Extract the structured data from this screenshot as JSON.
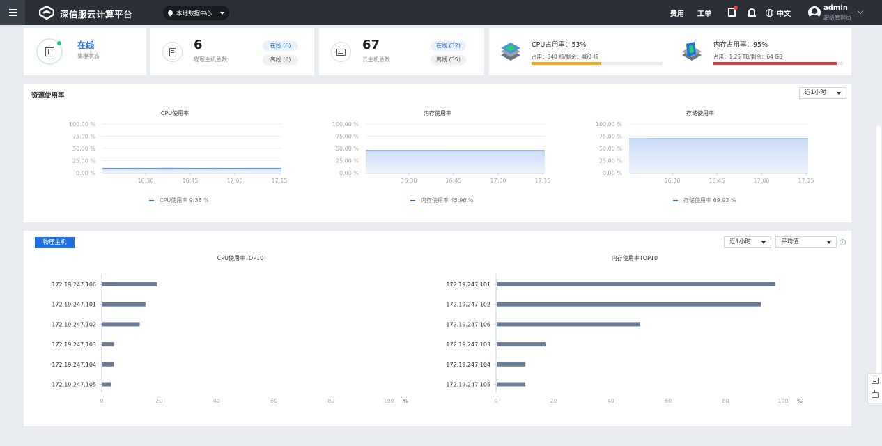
{
  "topbar": {
    "brand": "深信服云计算平台",
    "datacenter": "本地数据中心",
    "nav_fee": "费用",
    "nav_order": "工单",
    "lang": "中文",
    "user_name": "admin",
    "user_role": "超级管理员"
  },
  "cards": {
    "cluster": {
      "status": "在线",
      "label": "集群状态"
    },
    "hosts": {
      "total": "6",
      "label": "物理主机总数",
      "online": "在线 (6)",
      "offline": "离线 (0)"
    },
    "vms": {
      "total": "67",
      "label": "云主机总数",
      "online": "在线 (32)",
      "offline": "离线 (35)"
    },
    "cpu": {
      "title": "CPU占用率：53%",
      "detail": "占用：540 核/剩余：480 核",
      "percent": 53,
      "color": "#f5a623"
    },
    "mem": {
      "title": "内存占用率：95%",
      "detail": "占用：1.25 TB/剩余：64 GB",
      "percent": 95,
      "color": "#e0413f"
    }
  },
  "resource_panel": {
    "title": "资源使用率",
    "range": "近1小时",
    "charts": [
      {
        "title": "CPU使用率",
        "legend": "CPU使用率 9.38 %"
      },
      {
        "title": "内存使用率",
        "legend": "内存使用率 45.96 %"
      },
      {
        "title": "存储使用率",
        "legend": "存储使用率 69.92 %"
      }
    ]
  },
  "host_panel": {
    "tab": "物理主机",
    "range": "近1小时",
    "agg": "平均值",
    "cpu_title": "CPU使用率TOP10",
    "mem_title": "内存使用率TOP10"
  },
  "chart_data": [
    {
      "type": "area",
      "title": "CPU使用率",
      "yticks": [
        "100.00 %",
        "75.00 %",
        "50.00 %",
        "25.00 %",
        "0.00 %"
      ],
      "xticks": [
        "16:30",
        "16:45",
        "17:00",
        "17:15"
      ],
      "ylim": [
        0,
        100
      ],
      "series": [
        {
          "name": "CPU使用率",
          "values": [
            9.4,
            9.2,
            9.5,
            9.3,
            9.6,
            9.4,
            9.3,
            9.5,
            9.2,
            9.4,
            9.5,
            9.38
          ]
        }
      ]
    },
    {
      "type": "area",
      "title": "内存使用率",
      "yticks": [
        "100.00 %",
        "75.00 %",
        "50.00 %",
        "25.00 %",
        "0.00 %"
      ],
      "xticks": [
        "16:30",
        "16:45",
        "17:00",
        "17:15"
      ],
      "ylim": [
        0,
        100
      ],
      "series": [
        {
          "name": "内存使用率",
          "values": [
            45.9,
            45.96,
            45.95,
            45.96,
            45.97,
            45.96,
            45.95,
            45.96,
            45.96,
            45.97,
            45.96,
            45.96
          ]
        }
      ]
    },
    {
      "type": "area",
      "title": "存储使用率",
      "yticks": [
        "100.00 %",
        "75.00 %",
        "50.00 %",
        "25.00 %",
        "0.00 %"
      ],
      "xticks": [
        "16:30",
        "16:45",
        "17:00",
        "17:15"
      ],
      "ylim": [
        0,
        100
      ],
      "series": [
        {
          "name": "存储使用率",
          "values": [
            69.9,
            69.9,
            69.92,
            69.92,
            69.92,
            69.92,
            69.92,
            69.92,
            69.92,
            69.92,
            69.92,
            69.92
          ]
        }
      ]
    },
    {
      "type": "bar",
      "title": "CPU使用率TOP10",
      "categories": [
        "172.19.247.106",
        "172.19.247.101",
        "172.19.247.102",
        "172.19.247.103",
        "172.19.247.104",
        "172.19.247.105"
      ],
      "values": [
        19,
        15,
        13,
        4,
        4,
        3
      ],
      "xticks": [
        "0",
        "20",
        "40",
        "60",
        "80",
        "100"
      ],
      "unit": "%",
      "xlim": [
        0,
        100
      ]
    },
    {
      "type": "bar",
      "title": "内存使用率TOP10",
      "categories": [
        "172.19.247.101",
        "172.19.247.102",
        "172.19.247.106",
        "172.19.247.103",
        "172.19.247.104",
        "172.19.247.105"
      ],
      "values": [
        97,
        92,
        50,
        17,
        10,
        10
      ],
      "xticks": [
        "0",
        "20",
        "40",
        "60",
        "80",
        "100"
      ],
      "unit": "%",
      "xlim": [
        0,
        100
      ]
    }
  ]
}
